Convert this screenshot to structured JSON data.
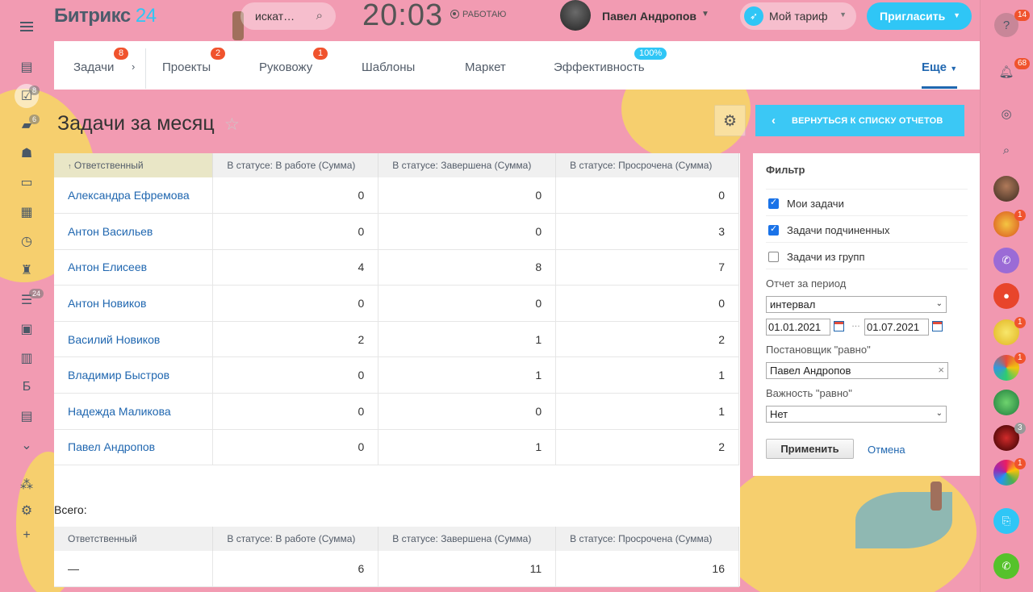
{
  "header": {
    "logo_text": "Битрикс",
    "logo_num": "24",
    "search_placeholder": "искат…",
    "clock": "20:03",
    "work_status": "РАБОТАЮ",
    "user_name": "Павел Андропов",
    "tariff_label": "Мой тариф",
    "invite_label": "Пригласить"
  },
  "left_sidebar": {
    "counters": {
      "tasks": "8",
      "chat": "6",
      "filter": "24"
    },
    "letter_item": "Б"
  },
  "tabs": [
    {
      "label": "Задачи",
      "badge": "8"
    },
    {
      "label": "Проекты",
      "badge": "2"
    },
    {
      "label": "Руковожу",
      "badge": "1"
    },
    {
      "label": "Шаблоны",
      "badge": ""
    },
    {
      "label": "Маркет",
      "badge": ""
    },
    {
      "label": "Эффективность",
      "badge": "100%"
    }
  ],
  "tabs_more": "Еще",
  "page": {
    "title": "Задачи за месяц",
    "back_button": "ВЕРНУТЬСЯ К СПИСКУ ОТЧЕТОВ"
  },
  "report": {
    "columns": [
      "Ответственный",
      "В статусе: В работе (Сумма)",
      "В статусе: Завершена (Сумма)",
      "В статусе: Просрочена (Сумма)"
    ],
    "rows": [
      {
        "name": "Александра Ефремова",
        "in_work": "0",
        "done": "0",
        "overdue": "0"
      },
      {
        "name": "Антон Васильев",
        "in_work": "0",
        "done": "0",
        "overdue": "3"
      },
      {
        "name": "Антон Елисеев",
        "in_work": "4",
        "done": "8",
        "overdue": "7"
      },
      {
        "name": "Антон Новиков",
        "in_work": "0",
        "done": "0",
        "overdue": "0"
      },
      {
        "name": "Василий Новиков",
        "in_work": "2",
        "done": "1",
        "overdue": "2"
      },
      {
        "name": "Владимир Быстров",
        "in_work": "0",
        "done": "1",
        "overdue": "1"
      },
      {
        "name": "Надежда Маликова",
        "in_work": "0",
        "done": "0",
        "overdue": "1"
      },
      {
        "name": "Павел Андропов",
        "in_work": "0",
        "done": "1",
        "overdue": "2"
      }
    ],
    "totals_label": "Всего:",
    "totals": {
      "name": "—",
      "in_work": "6",
      "done": "11",
      "overdue": "16"
    }
  },
  "filter": {
    "title": "Фильтр",
    "checks": [
      {
        "label": "Мои задачи",
        "checked": true
      },
      {
        "label": "Задачи подчиненных",
        "checked": true
      },
      {
        "label": "Задачи из групп",
        "checked": false
      }
    ],
    "period_label": "Отчет за период",
    "period_value": "интервал",
    "date_from": "01.01.2021",
    "date_to": "01.07.2021",
    "date_sep": "…",
    "author_label": "Постановщик \"равно\"",
    "author_value": "Павел Андропов",
    "priority_label": "Важность \"равно\"",
    "priority_value": "Нет",
    "apply_label": "Применить",
    "cancel_label": "Отмена"
  },
  "right_sidebar": {
    "badges": {
      "help": "14",
      "notifications": "68",
      "contact2": "1",
      "contact6": "1",
      "contact7": "1",
      "contact9": "3",
      "contact10": "1"
    }
  },
  "colors": {
    "accent": "#2fc6f6",
    "link": "#2067b0",
    "badge": "#f0532d",
    "background": "#f29bb2"
  }
}
